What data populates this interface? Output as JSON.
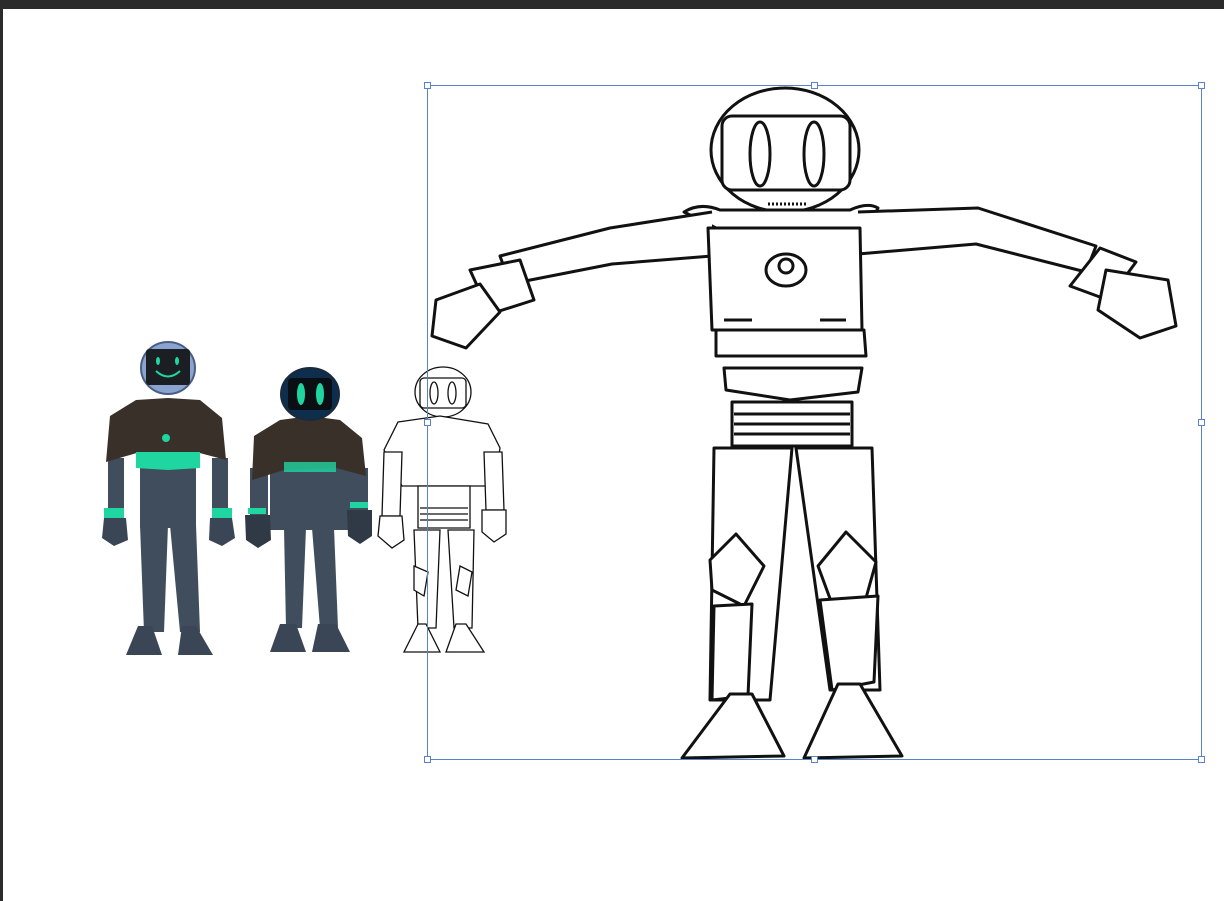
{
  "document": {
    "background": "#ffffff",
    "chrome_color": "#2b2b2b",
    "selection_color": "#5a82c8"
  },
  "artwork": {
    "figures": [
      {
        "name": "robot-colored-smile",
        "style": "colored",
        "eyes": "smile"
      },
      {
        "name": "robot-colored-oval-eyes",
        "style": "colored",
        "eyes": "oval"
      },
      {
        "name": "robot-lineart-small",
        "style": "lineart",
        "eyes": "oval"
      },
      {
        "name": "robot-lineart-tpose",
        "style": "lineart",
        "pose": "t-pose",
        "selected": true
      }
    ],
    "palette": {
      "body": "#3c4a5a",
      "accent": "#1fd6a0",
      "cape": "#3a302a",
      "head_light": "#8aa4cf",
      "head_dark": "#0e2e4e",
      "ink": "#111111"
    }
  },
  "selection": {
    "handles": [
      "top-left",
      "top-middle",
      "top-right",
      "middle-left",
      "middle-right",
      "bottom-left",
      "bottom-middle",
      "bottom-right"
    ]
  }
}
